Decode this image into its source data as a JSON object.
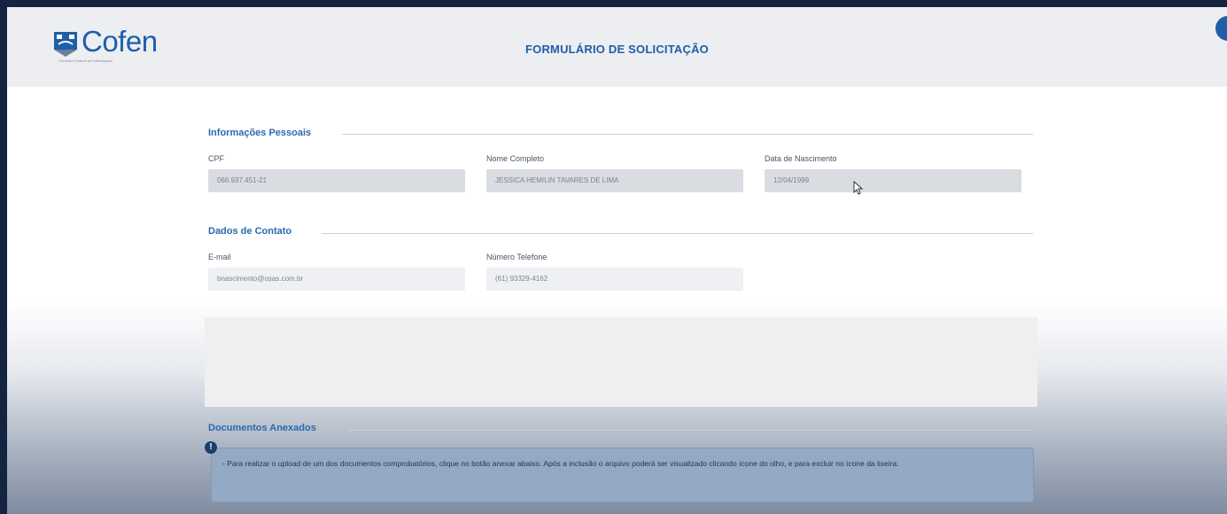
{
  "header": {
    "logo_text": "Cofen",
    "logo_subtitle": "Conselho Federal de Enfermagem",
    "title": "FORMULÁRIO DE SOLICITAÇÃO"
  },
  "personal": {
    "section_title": "Informações Pessoais",
    "cpf": {
      "label": "CPF",
      "value": "066.937.451-21"
    },
    "name": {
      "label": "Nome Completo",
      "value": "JESSICA HEMILIN TAVARES DE LIMA"
    },
    "birth": {
      "label": "Data de Nascimento",
      "value": "12/04/1999"
    }
  },
  "contact": {
    "section_title": "Dados de Contato",
    "email": {
      "label": "E-mail",
      "value": "bnascimento@osas.com.br"
    },
    "phone": {
      "label": "Número Telefone",
      "value": "(61) 93329-4162"
    }
  },
  "documents": {
    "section_title": "Documentos Anexados",
    "info_text": "- Para realizar o upload de um dos documentos comprobatórios, clique no botão anexar abaixo. Após a inclusão o arquivo poderá ser visualizado clicando ícone do olho, e para excluir no ícone da lixeira."
  },
  "icons": {
    "logo": "cofen-logo-icon",
    "cursor": "mouse-cursor-icon",
    "info": "info-icon"
  },
  "colors": {
    "accent": "#1f5ea8",
    "section_title": "#2a6ab0",
    "info_box": "#94a9c3",
    "frame": "#14233f"
  }
}
